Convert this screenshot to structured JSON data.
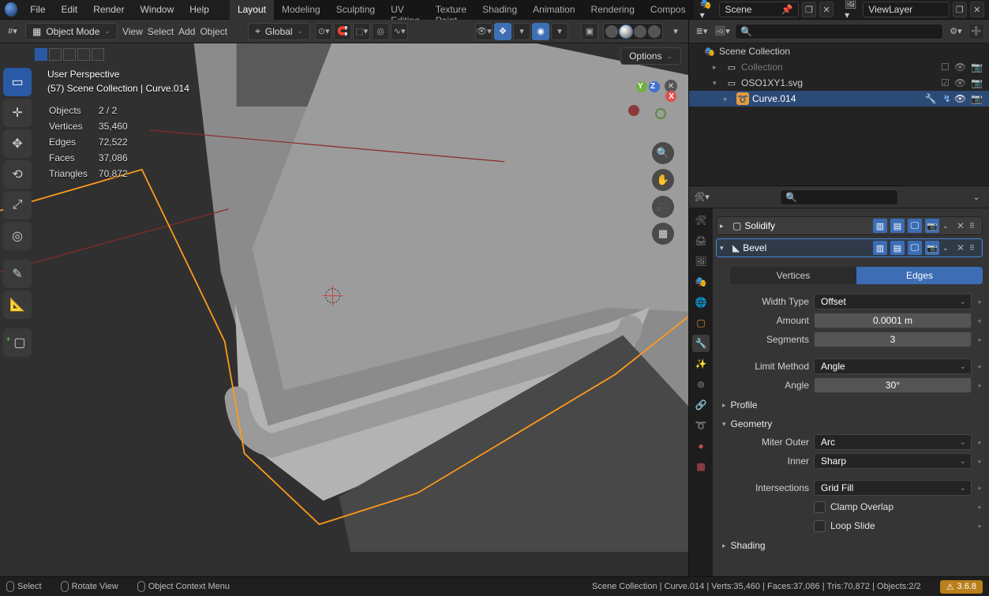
{
  "top_menu": {
    "items": [
      "File",
      "Edit",
      "Render",
      "Window",
      "Help"
    ]
  },
  "workspaces": {
    "tabs": [
      "Layout",
      "Modeling",
      "Sculpting",
      "UV Editing",
      "Texture Paint",
      "Shading",
      "Animation",
      "Rendering",
      "Compos"
    ],
    "active_index": 0
  },
  "top_right": {
    "scene_label": "Scene",
    "viewlayer_label": "ViewLayer"
  },
  "view_header": {
    "mode": "Object Mode",
    "menus": [
      "View",
      "Select",
      "Add",
      "Object"
    ],
    "orientation": "Global",
    "options_label": "Options"
  },
  "stats": {
    "title1": "User Perspective",
    "title2": "(57) Scene Collection | Curve.014",
    "rows": [
      [
        "Objects",
        "2 / 2"
      ],
      [
        "Vertices",
        "35,460"
      ],
      [
        "Edges",
        "72,522"
      ],
      [
        "Faces",
        "37,086"
      ],
      [
        "Triangles",
        "70,872"
      ]
    ]
  },
  "outliner": {
    "root": "Scene Collection",
    "collection": "Collection",
    "file": "OSO1XY1.svg",
    "curve": "Curve.014"
  },
  "modifiers": {
    "solidify": {
      "name": "Solidify"
    },
    "bevel": {
      "name": "Bevel",
      "tabs": [
        "Vertices",
        "Edges"
      ],
      "tabs_active": 1,
      "width_type_label": "Width Type",
      "width_type_value": "Offset",
      "amount_label": "Amount",
      "amount_value": "0.0001 m",
      "segments_label": "Segments",
      "segments_value": "3",
      "limit_method_label": "Limit Method",
      "limit_method_value": "Angle",
      "angle_label": "Angle",
      "angle_value": "30°",
      "profile_label": "Profile",
      "geometry_label": "Geometry",
      "miter_outer_label": "Miter Outer",
      "miter_outer_value": "Arc",
      "inner_label": "Inner",
      "inner_value": "Sharp",
      "intersections_label": "Intersections",
      "intersections_value": "Grid Fill",
      "clamp_label": "Clamp Overlap",
      "loopslide_label": "Loop Slide",
      "shading_label": "Shading"
    }
  },
  "statusbar": {
    "select": "Select",
    "rotate": "Rotate View",
    "context": "Object Context Menu",
    "info": "Scene Collection | Curve.014 | Verts:35,460 | Faces:37,086 | Tris:70,872 | Objects:2/2",
    "version": "3.6.8"
  }
}
